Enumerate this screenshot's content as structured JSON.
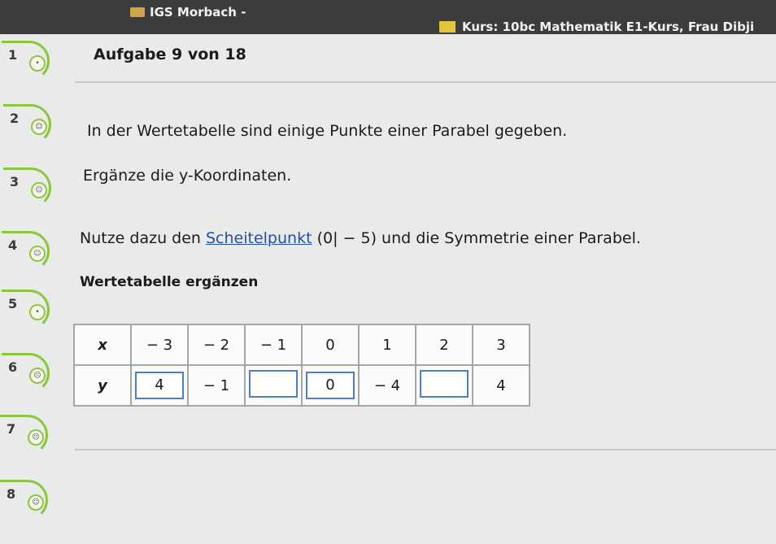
{
  "topbar": {
    "school": "IGS Morbach -",
    "course": "Kurs: 10bc Mathematik E1-Kurs, Frau Dibji"
  },
  "sidebar": {
    "items": [
      {
        "number": "1",
        "status_icon": "smiley-neutral-icon"
      },
      {
        "number": "2",
        "status_icon": "smiley-happy-icon"
      },
      {
        "number": "3",
        "status_icon": "smiley-happy-icon"
      },
      {
        "number": "4",
        "status_icon": "smiley-happy-icon"
      },
      {
        "number": "5",
        "status_icon": "smiley-neutral-icon"
      },
      {
        "number": "6",
        "status_icon": "smiley-sad-icon"
      },
      {
        "number": "7",
        "status_icon": "smiley-sad-icon"
      },
      {
        "number": "8",
        "status_icon": "smiley-happy-icon"
      }
    ]
  },
  "task": {
    "title": "Aufgabe 9 von 18",
    "line1": "In der Wertetabelle sind einige Punkte einer Parabel gegeben.",
    "line2": "Ergänze die y-Koordinaten.",
    "line3_before": "Nutze dazu den ",
    "line3_link": "Scheitelpunkt",
    "line3_after": " (0| − 5) und die Symmetrie einer Parabel.",
    "subheading": "Wertetabelle ergänzen"
  },
  "table": {
    "x_label": "x",
    "y_label": "y",
    "x_values": [
      "− 3",
      "− 2",
      "− 1",
      "0",
      "1",
      "2",
      "3"
    ],
    "y_values": [
      {
        "value": "4",
        "input": true
      },
      {
        "value": "− 1",
        "input": false
      },
      {
        "value": "",
        "input": true
      },
      {
        "value": "0",
        "input": true
      },
      {
        "value": "− 4",
        "input": false
      },
      {
        "value": "",
        "input": true
      },
      {
        "value": "4",
        "input": false
      }
    ]
  },
  "colors": {
    "accent_green": "#8cc63f",
    "input_border": "#4a7fc1",
    "link": "#1f4fb0",
    "topbar": "#3a3d3c"
  }
}
